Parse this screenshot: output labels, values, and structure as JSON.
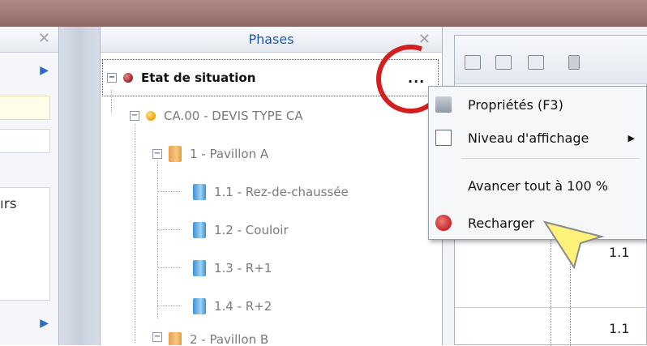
{
  "left_panel": {
    "close_glyph": "✕",
    "partial_text": "ırs"
  },
  "phases_panel": {
    "title": "Phases",
    "close_glyph": "✕",
    "ellipsis": "...",
    "tree": [
      {
        "label": "Etat de situation",
        "icon": "red-dot-icon"
      },
      {
        "label": "CA.00 - DEVIS TYPE CA",
        "icon": "orange-dot-icon"
      },
      {
        "label": "1 - Pavillon A",
        "icon": "orange-book-icon"
      },
      {
        "label": "1.1 - Rez-de-chaussée",
        "icon": "blue-book-icon"
      },
      {
        "label": "1.2 - Couloir",
        "icon": "blue-book-icon"
      },
      {
        "label": "1.3 - R+1",
        "icon": "blue-book-icon"
      },
      {
        "label": "1.4 - R+2",
        "icon": "blue-book-icon"
      },
      {
        "label": "2 - Pavillon B",
        "icon": "orange-book-icon"
      }
    ],
    "expander_glyph": "−"
  },
  "right_panel": {
    "cells": [
      "1.1",
      "1.1"
    ]
  },
  "context_menu": {
    "items": [
      {
        "label": "Propriétés (F3)",
        "icon": "properties-icon"
      },
      {
        "label": "Niveau d'affichage",
        "icon": "display-level-icon",
        "submenu_glyph": "▶"
      },
      {
        "label": "Avancer tout à 100 %",
        "icon": ""
      },
      {
        "label": "Recharger",
        "icon": "reload-icon"
      }
    ]
  },
  "colors": {
    "title_blue": "#1f57b5",
    "highlight_red": "#d31f1f",
    "cursor_yellow": "#fff27a"
  }
}
